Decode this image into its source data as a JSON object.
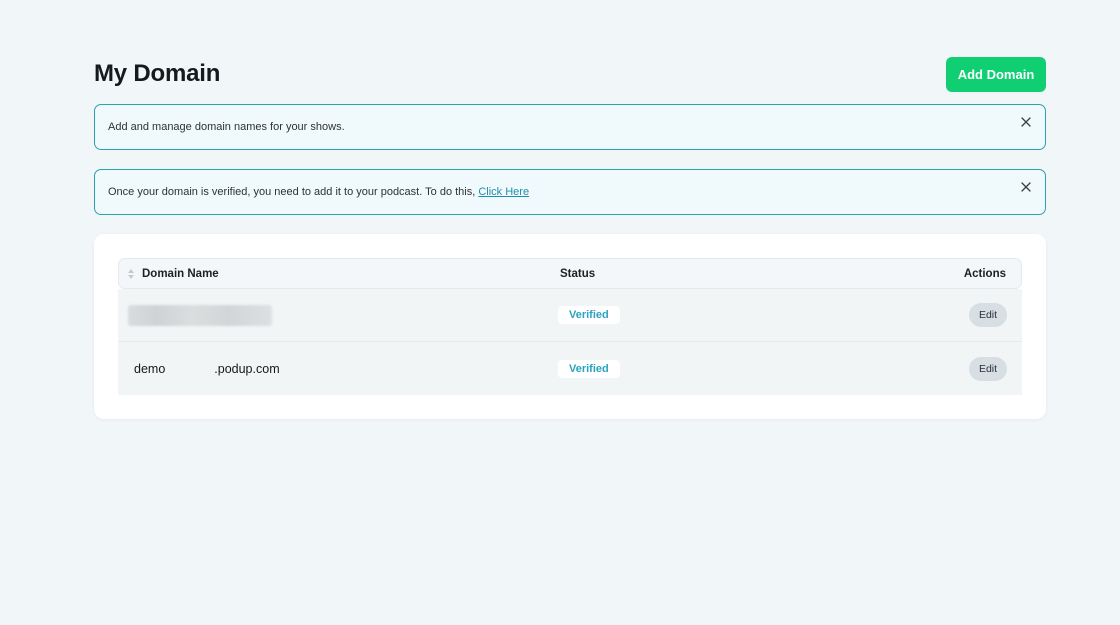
{
  "page": {
    "title": "My Domain",
    "add_button_label": "Add Domain"
  },
  "alerts": [
    {
      "text": "Add and manage domain names for your shows."
    },
    {
      "text": "Once your domain is verified, you need to add it to your podcast. To do this, ",
      "link_text": "Click Here"
    }
  ],
  "table": {
    "columns": {
      "name": "Domain Name",
      "status": "Status",
      "actions": "Actions"
    },
    "rows": [
      {
        "domain": "",
        "domain_redacted": true,
        "status": "Verified",
        "action": "Edit"
      },
      {
        "domain_prefix": "demo",
        "domain_suffix": ".podup.com",
        "status": "Verified",
        "action": "Edit"
      }
    ]
  },
  "colors": {
    "accent_green": "#0fcf72",
    "alert_border": "#2ba3ad",
    "link": "#1f8fb0",
    "verified": "#2ba3bf"
  },
  "icons": {
    "close": "close-icon",
    "sort": "sort-icon"
  }
}
